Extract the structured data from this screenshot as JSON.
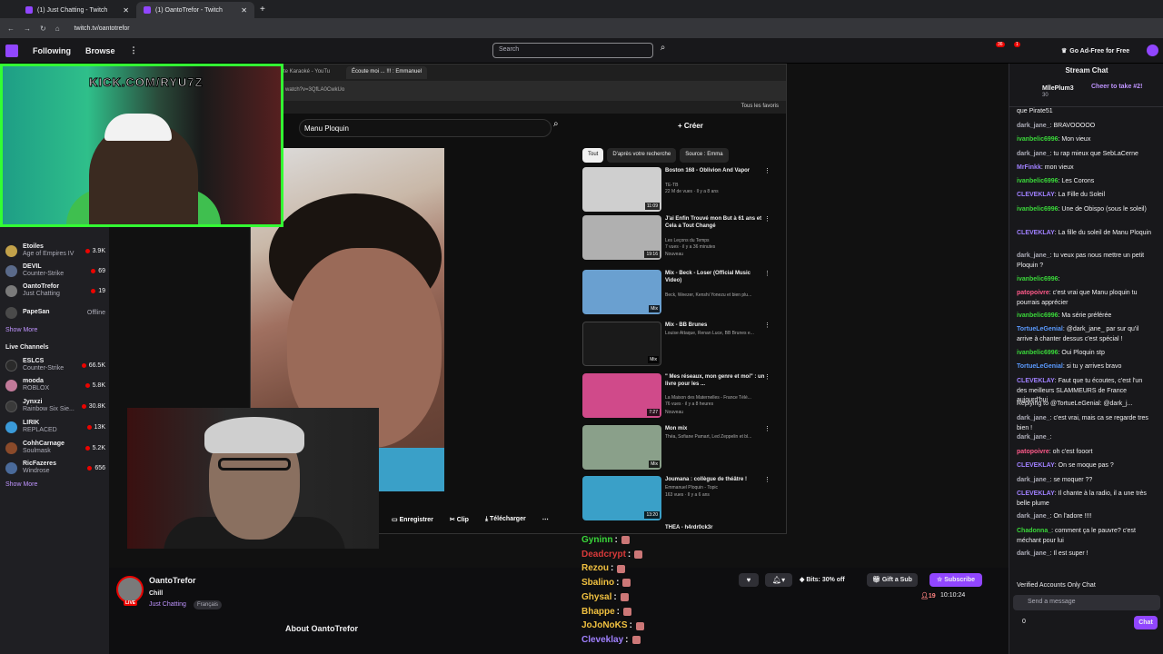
{
  "browser": {
    "tabs": [
      "(1) Just Chatting - Twitch",
      "(1) OantoTrefor - Twitch"
    ],
    "url": "twitch.tv/oantotrefor"
  },
  "topnav": {
    "following": "Following",
    "browse": "Browse",
    "search_placeholder": "Search",
    "ad_free": "Go Ad-Free for Free",
    "badge_a": "36",
    "badge_b": "1"
  },
  "sidebar": {
    "followed": [
      {
        "name": "Etoiles",
        "game": "Age of Empires IV",
        "viewers": "3.9K",
        "color": "#c2a14a"
      },
      {
        "name": "DEVIL",
        "game": "Counter-Strike",
        "viewers": "69",
        "color": "#5a6a8a"
      },
      {
        "name": "OantoTrefor",
        "game": "Just Chatting",
        "viewers": "19",
        "color": "#7a7a7a"
      },
      {
        "name": "PapeSan",
        "game": "",
        "viewers": "Offline",
        "color": "#4a4a4a"
      }
    ],
    "show_more": "Show More",
    "live_channels_title": "Live Channels",
    "live": [
      {
        "name": "ESLCS",
        "game": "Counter-Strike",
        "viewers": "66.5K",
        "color": "#2a2a2a"
      },
      {
        "name": "mooda",
        "game": "ROBLOX",
        "viewers": "5.8K",
        "color": "#c27a9a"
      },
      {
        "name": "Jynxzi",
        "game": "Rainbow Six Sie...",
        "viewers": "30.8K",
        "color": "#3a3a3a"
      },
      {
        "name": "LIRIK",
        "game": "REPLACED",
        "viewers": "13K",
        "color": "#3a9ad8"
      },
      {
        "name": "CohhCarnage",
        "game": "Soulmask",
        "viewers": "5.2K",
        "color": "#8a4a2a"
      },
      {
        "name": "RicFazeres",
        "game": "Windrose",
        "viewers": "656",
        "color": "#4a6a9a"
      }
    ],
    "show_more_2": "Show More"
  },
  "overlay": {
    "kick": "KICK.COM/RYU7Z"
  },
  "youtube": {
    "tab1": "te Karaoké - YouTu",
    "tab2": "Écoute moi ... !!! : Emmanuel",
    "url": "watch?v=3QfLA0CwkUo",
    "favorites": "Tous les favoris",
    "search_value": "Manu Ploquin",
    "create": "Créer",
    "chips": [
      "Tout",
      "D'après votre recherche",
      "Source : Emma"
    ],
    "videos": [
      {
        "title": "Boston 168 - Oblivion And Vapor",
        "channel": "TE-TB",
        "stats": "22 M de vues · Il y a 8 ans",
        "dur": "11:09",
        "color": "#cfcfcf"
      },
      {
        "title": "J'ai Enfin Trouvé mon But à 61 ans et Cela a Tout Changé",
        "channel": "Les Leçons du Temps",
        "stats": "7 vues · il y a 36 minutes",
        "dur": "19:16",
        "color": "#b0b0b0",
        "badge": "Nouveau"
      },
      {
        "title": "Mix - Beck - Loser (Official Music Video)",
        "channel": "Beck, Weezer, Kenshi Yonezu et bien plu...",
        "stats": "",
        "dur": "Mix",
        "color": "#6aa0d0"
      },
      {
        "title": "Mix - BB Brunes",
        "channel": "Louise Attaque, Renan Luce, BB Brunes e...",
        "stats": "",
        "dur": "Mix",
        "color": "#1a1a1a"
      },
      {
        "title": "\" Mes réseaux, mon genre et moi\" : un livre pour les ...",
        "channel": "La Maison des Maternelles - France Télé...",
        "stats": "76 vues · il y a 8 heures",
        "dur": "7:27",
        "color": "#d04a8a",
        "badge": "Nouveau"
      },
      {
        "title": "Mon mix",
        "channel": "Théa, Sofiane Pamart, Led Zeppelin et bl...",
        "stats": "",
        "dur": "Mix",
        "color": "#8aa08a"
      },
      {
        "title": "Joumana : collègue de théâtre !",
        "channel": "Emmanuel Ploquin - Topic",
        "stats": "163 vues · Il y a 6 ans",
        "dur": "13:20",
        "color": "#3aa0c8"
      },
      {
        "title": "THÉA - h4rdr0ck3r",
        "channel": "",
        "stats": "",
        "dur": "",
        "color": "#2a2a2a"
      }
    ],
    "actions": [
      "Enregistrer",
      "Clip",
      "Télécharger"
    ]
  },
  "hype_names": [
    {
      "name": "Gyninn",
      "color": "#3ad83a"
    },
    {
      "name": "Deadcrypt",
      "color": "#d83a3a"
    },
    {
      "name": "Rezou",
      "color": "#f0c040"
    },
    {
      "name": "Sbalino",
      "color": "#f0c040"
    },
    {
      "name": "Ghysal",
      "color": "#f0c040"
    },
    {
      "name": "Bhappe",
      "color": "#f0c040"
    },
    {
      "name": "JoJoNoKS",
      "color": "#f0c040"
    },
    {
      "name": "Cleveklay",
      "color": "#a080ff"
    }
  ],
  "channel": {
    "name": "OantoTrefor",
    "title": "Chill",
    "category": "Just Chatting",
    "tag": "Français",
    "live": "LIVE",
    "about": "About OantoTrefor",
    "bits": "Bits: 30% off",
    "gift": "Gift a Sub",
    "subscribe": "Subscribe",
    "viewers": "19",
    "uptime": "10:10:24"
  },
  "chat": {
    "title": "Stream Chat",
    "pinned_user": "MllePlum3",
    "pinned_count": "30",
    "pinned_text": "Cheer to take #2!",
    "messages": [
      {
        "user": "",
        "color": "#efeff1",
        "text": "que Pirate51"
      },
      {
        "user": "dark_jane_",
        "color": "#adadb8",
        "text": ": BRAVOOOOO"
      },
      {
        "user": "ivanbelic6996",
        "color": "#3ad83a",
        "text": ": Mon vieux"
      },
      {
        "user": "dark_jane_",
        "color": "#adadb8",
        "text": ": tu rap mieux que SebLaCerne"
      },
      {
        "user": "MrFinkk",
        "color": "#a080ff",
        "text": ": mon vieux"
      },
      {
        "user": "ivanbelic6996",
        "color": "#3ad83a",
        "text": ": Les Corons"
      },
      {
        "user": "CLEVEKLAY",
        "color": "#a080ff",
        "text": ": La Fille du Soleil"
      },
      {
        "user": "ivanbelic6996",
        "color": "#3ad83a",
        "text": ": Une de Obispo (sous le soleil)"
      },
      {
        "user": "CLEVEKLAY",
        "color": "#a080ff",
        "text": ": La fille du soleil de Manu Ploquin"
      },
      {
        "user": "dark_jane_",
        "color": "#adadb8",
        "text": ": tu veux pas nous mettre un petit Ploquin ?"
      },
      {
        "user": "ivanbelic6996",
        "color": "#3ad83a",
        "text": ":"
      },
      {
        "user": "patopoivre",
        "color": "#ff5a8a",
        "text": ": c'est vrai que Manu ploquin tu pourrais apprécier"
      },
      {
        "user": "ivanbelic6996",
        "color": "#3ad83a",
        "text": ": Ma série préférée"
      },
      {
        "user": "TortueLeGenial",
        "color": "#5a9aff",
        "text": ": @dark_jane_ par sur qu'il arrive à chanter dessus c'est spécial !"
      },
      {
        "user": "ivanbelic6996",
        "color": "#3ad83a",
        "text": ": Oui Ploquin stp"
      },
      {
        "user": "TortueLeGenial",
        "color": "#5a9aff",
        "text": ": si tu y arrives bravo"
      },
      {
        "user": "CLEVEKLAY",
        "color": "#a080ff",
        "text": ": Faut que tu écoutes, c'est l'un des meilleurs SLAMMEURS de France aujourd'hui"
      },
      {
        "user": "",
        "color": "#adadb8",
        "text": "Replying to @TortueLeGenial: @dark_j..."
      },
      {
        "user": "dark_jane_",
        "color": "#adadb8",
        "text": ": c'est vrai, mais ca se regarde tres bien !"
      },
      {
        "user": "dark_jane_",
        "color": "#adadb8",
        "text": ":"
      },
      {
        "user": "patopoivre",
        "color": "#ff5a8a",
        "text": ": oh c'est fooort"
      },
      {
        "user": "CLEVEKLAY",
        "color": "#a080ff",
        "text": ": On se moque pas ?"
      },
      {
        "user": "dark_jane_",
        "color": "#adadb8",
        "text": ": se moquer ??"
      },
      {
        "user": "CLEVEKLAY",
        "color": "#a080ff",
        "text": ": Il chante à la radio, il a une très belle plume"
      },
      {
        "user": "dark_jane_",
        "color": "#adadb8",
        "text": ": On l'adore !!!!"
      },
      {
        "user": "Chadonna_",
        "color": "#3ad83a",
        "text": ": comment ça le pauvre? c'est méchant pour lui"
      },
      {
        "user": "dark_jane_",
        "color": "#adadb8",
        "text": ": Il est super !"
      }
    ],
    "banner": "Verified Accounts Only Chat",
    "input_placeholder": "Send a message",
    "points": "0",
    "send": "Chat"
  }
}
